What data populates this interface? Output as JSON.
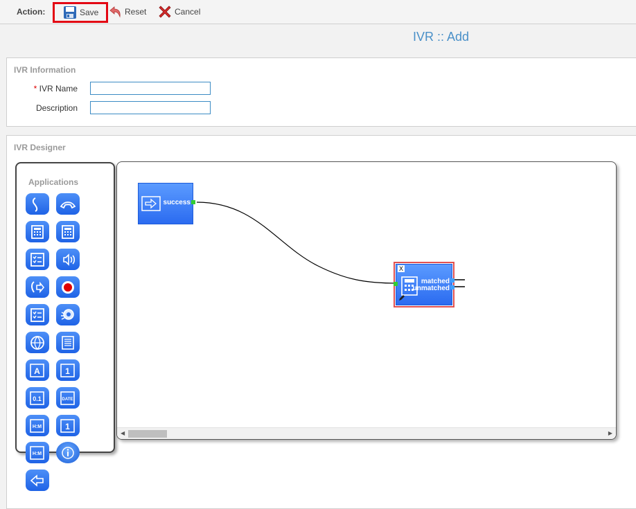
{
  "toolbar": {
    "action_label": "Action:",
    "save_label": "Save",
    "reset_label": "Reset",
    "cancel_label": "Cancel"
  },
  "page": {
    "title": "IVR :: Add"
  },
  "ivr_info": {
    "section_title": "IVR Information",
    "required_mark": "*",
    "name_label": "IVR Name",
    "name_value": "",
    "description_label": "Description",
    "description_value": ""
  },
  "designer": {
    "section_title": "IVR Designer",
    "palette_title": "Applications",
    "applications": [
      "answer-icon",
      "hangup-icon",
      "calculator-icon",
      "calculator-icon",
      "checklist-icon",
      "speaker-icon",
      "transfer-call-icon",
      "record-icon",
      "checklist-icon",
      "speech-recognition-icon",
      "globe-icon",
      "menu-list-icon",
      "say-alpha-icon",
      "say-digits-icon",
      "say-number-icon",
      "say-date-icon",
      "say-time-icon",
      "say-digit-icon",
      "say-time-icon",
      "info-icon",
      "back-arrow-icon"
    ],
    "nodes": {
      "start": {
        "port_label": "success"
      },
      "menu": {
        "close_label": "X",
        "matched_label": "matched",
        "unmatched_label": "unmatched"
      }
    }
  },
  "colors": {
    "accent": "#4a90c8",
    "node_blue": "#3a7cf5",
    "save_highlight": "#e30613",
    "port_green": "#33cc33"
  }
}
